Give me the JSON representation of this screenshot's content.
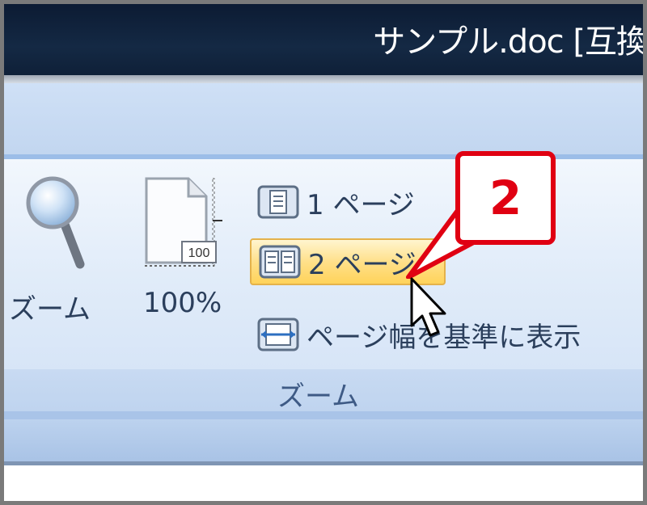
{
  "window": {
    "title": "サンプル.doc [互換"
  },
  "ribbon": {
    "zoom_button": {
      "label": "ズーム",
      "icon": "magnifier-icon"
    },
    "hundred_percent_button": {
      "label": "100%",
      "icon": "page-100-icon",
      "badge": "100"
    },
    "one_page_button": {
      "label": "1 ページ",
      "icon": "single-page-icon"
    },
    "two_pages_button": {
      "label": "2 ページ",
      "icon": "two-pages-icon",
      "highlighted": true
    },
    "page_width_button": {
      "label": "ページ幅を基準に表示",
      "icon": "page-width-icon"
    },
    "group_label": "ズーム"
  },
  "callout": {
    "number": "2",
    "color": "#e00012"
  },
  "colors": {
    "title_bar": "#142944",
    "ribbon": "#e1ecf9",
    "hover": "#ffe08a"
  }
}
